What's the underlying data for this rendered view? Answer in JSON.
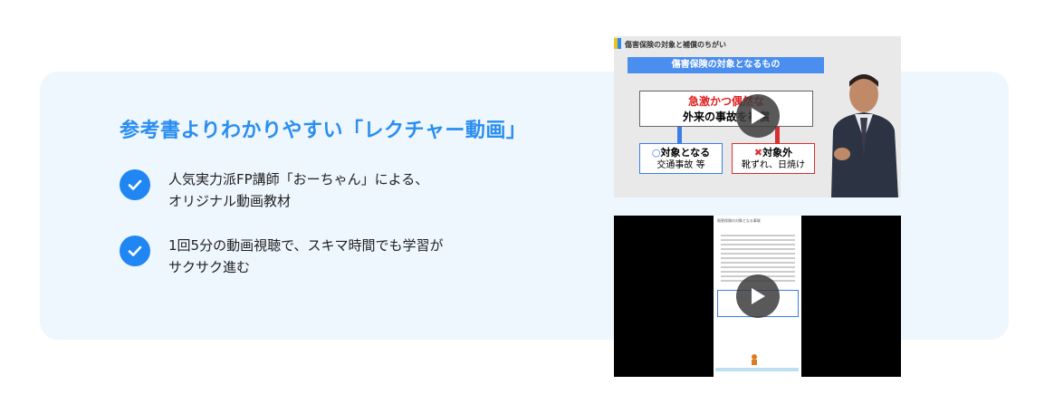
{
  "heading": "参考書よりわかりやすい「レクチャー動画」",
  "features": [
    {
      "text": "人気実力派FP講師「おーちゃん」による、\nオリジナル動画教材"
    },
    {
      "text": "1回5分の動画視聴で、スキマ時間でも学習が\nサクサク進む"
    }
  ],
  "video1": {
    "slide_title": "傷害保険の対象と補償のちがい",
    "banner": "傷害保険の対象となるもの",
    "box_line1": "急激かつ偶然な",
    "box_line2": "外来の事故を補償",
    "target_label": "対象となる",
    "target_example": "交通事故 等",
    "excluded_label": "対象外",
    "excluded_example": "靴ずれ、日焼け"
  },
  "video2": {
    "page_title": "傷害保険の対象となる事故"
  }
}
